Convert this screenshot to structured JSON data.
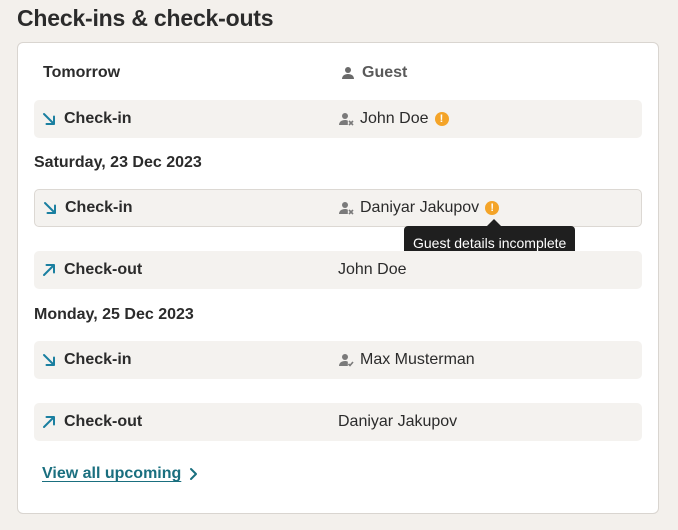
{
  "page": {
    "title": "Check-ins & check-outs"
  },
  "table_header": {
    "when_label": "Tomorrow",
    "guest_label": "Guest",
    "guest_icon": "person-icon"
  },
  "groups": [
    {
      "date": "Tomorrow",
      "rows": [
        {
          "type": "Check-in",
          "direction": "in",
          "guest": "John Doe",
          "guest_icon": "person-x-icon",
          "warning": true
        }
      ]
    },
    {
      "date": "Saturday, 23 Dec 2023",
      "rows": [
        {
          "type": "Check-in",
          "direction": "in",
          "guest": "Daniyar Jakupov",
          "guest_icon": "person-x-icon",
          "warning": true
        },
        {
          "type": "Check-out",
          "direction": "out",
          "guest": "John Doe",
          "guest_icon": "",
          "warning": false
        }
      ]
    },
    {
      "date": "Monday, 25 Dec 2023",
      "rows": [
        {
          "type": "Check-in",
          "direction": "in",
          "guest": "Max Musterman",
          "guest_icon": "person-check-icon",
          "warning": false
        },
        {
          "type": "Check-out",
          "direction": "out",
          "guest": "Daniyar Jakupov",
          "guest_icon": "",
          "warning": false
        }
      ]
    }
  ],
  "tooltip": {
    "text": "Guest details incomplete"
  },
  "footer": {
    "view_all_label": "View all upcoming"
  },
  "colors": {
    "accent": "#1a6f7f",
    "warning": "#f4a428",
    "arrow": "#1a7fa0"
  }
}
